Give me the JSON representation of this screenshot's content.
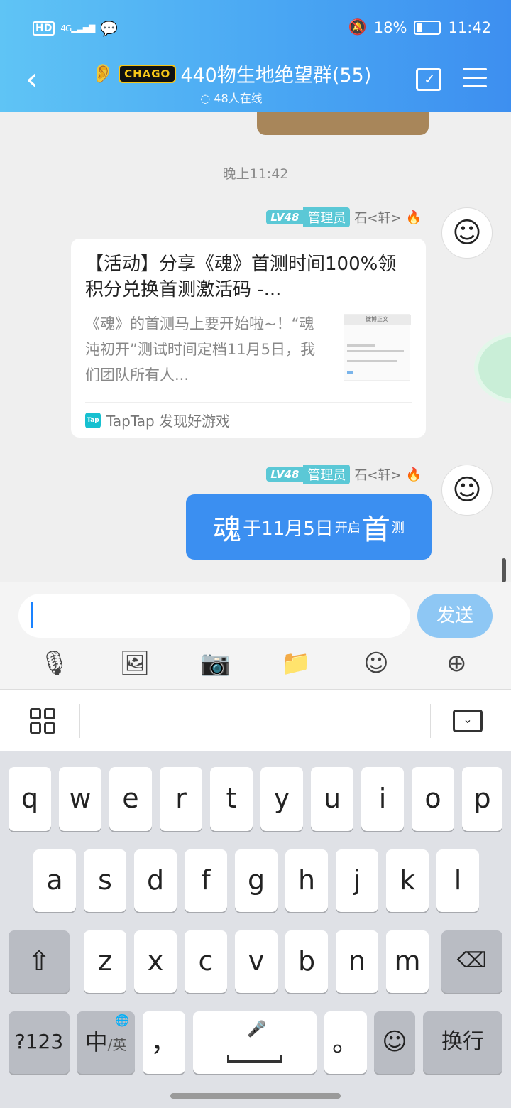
{
  "status_bar": {
    "time": "11:42",
    "battery": "18%",
    "left_badge": "HD",
    "network": "4G"
  },
  "header": {
    "title": "440物生地绝望群(55)",
    "logo_text": "CHAGO",
    "online": "48人在线"
  },
  "chat": {
    "timestamp": "晚上11:42",
    "messages": [
      {
        "level": "LV48",
        "role": "管理员",
        "sender": "石<轩>",
        "card": {
          "title": "【活动】分享《魂》首测时间100%领积分兑换首测激活码 -...",
          "desc": "《魂》的首测马上要开始啦~！“魂沌初开”测试时间定档11月5日，我们团队所有人...",
          "source": "TapTap 发现好游戏",
          "source_icon": "Tap",
          "thumb_text": "微博正文"
        }
      },
      {
        "level": "LV48",
        "role": "管理员",
        "sender": "石<轩>",
        "text_parts": [
          "魂",
          "于11月5日",
          "开启",
          "首",
          "测"
        ]
      }
    ]
  },
  "input": {
    "placeholder": "",
    "send_label": "发送"
  },
  "toolbar": [
    "microphone-icon",
    "image-icon",
    "camera-icon",
    "folder-icon",
    "emoji-icon",
    "plus-icon"
  ],
  "keyboard": {
    "row1": [
      "q",
      "w",
      "e",
      "r",
      "t",
      "y",
      "u",
      "i",
      "o",
      "p"
    ],
    "row2": [
      "a",
      "s",
      "d",
      "f",
      "g",
      "h",
      "j",
      "k",
      "l"
    ],
    "row3": [
      "z",
      "x",
      "c",
      "v",
      "b",
      "n",
      "m"
    ],
    "sym": "?123",
    "lang_main": "中",
    "lang_sub": "/英",
    "comma": "，",
    "period": "。",
    "enter": "换行"
  }
}
